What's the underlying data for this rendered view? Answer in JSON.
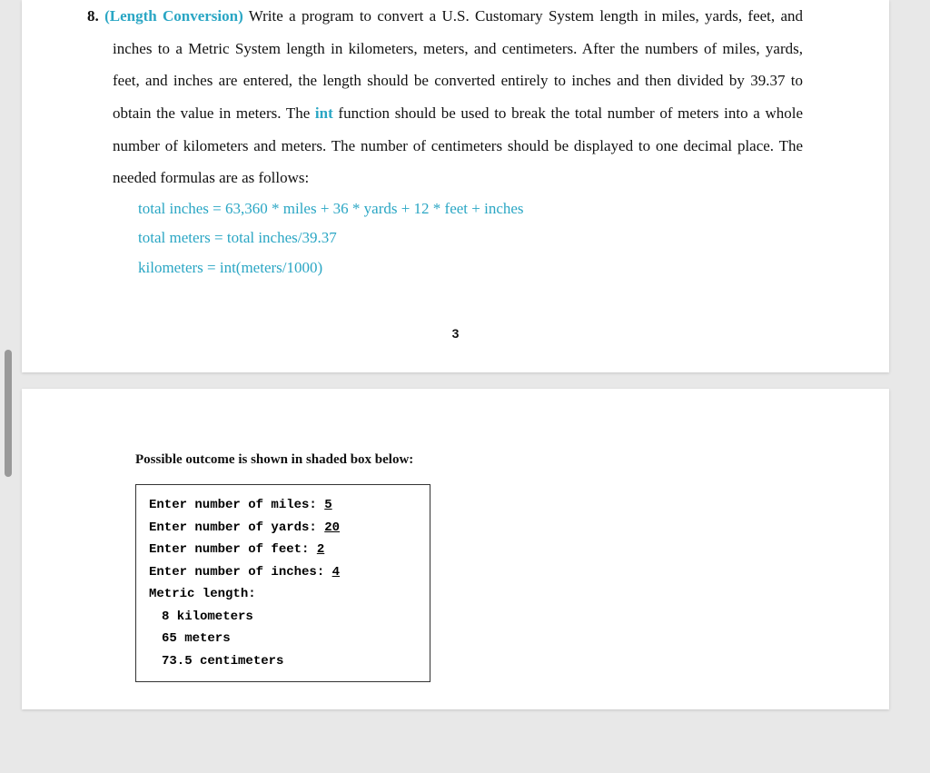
{
  "problem": {
    "number": "8.",
    "title": "(Length Conversion)",
    "body_part1": " Write a program to convert a U.S. Customary System length in miles, yards, feet, and inches to a Metric System length in kilometers, meters, and centimeters. After the numbers of miles, yards, feet, and inches are entered, the length should be converted entirely to inches and then divided by 39.37 to obtain the value in meters. The ",
    "int_keyword": "int",
    "body_part2": " function should be used to break the total number of meters into a whole number of kilometers and meters. The number of centimeters should be displayed to one decimal place. The needed formulas are as follows:"
  },
  "formulas": {
    "line1": "total inches = 63,360 * miles + 36 * yards + 12 * feet + inches",
    "line2": "total meters = total inches/39.37",
    "line3": "kilometers = int(meters/1000)"
  },
  "page_number": "3",
  "outcome": {
    "heading": "Possible outcome is shown in shaded box below:",
    "prompts": {
      "miles_label": "Enter number of miles: ",
      "miles_value": "5",
      "yards_label": "Enter number of yards: ",
      "yards_value": "20",
      "feet_label": "Enter number of feet: ",
      "feet_value": "2",
      "inches_label": "Enter number of inches: ",
      "inches_value": "4",
      "metric_heading": "Metric length:",
      "km": "8 kilometers",
      "m": "65 meters",
      "cm": "73.5 centimeters"
    }
  }
}
